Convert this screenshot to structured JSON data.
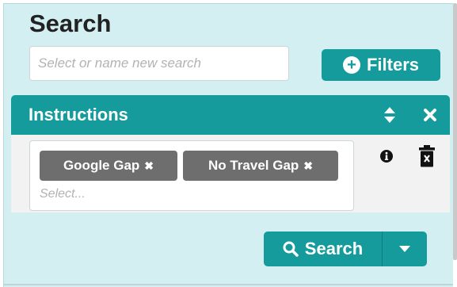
{
  "panel": {
    "title": "Search",
    "search_input": {
      "placeholder": "Select or name new search",
      "value": ""
    },
    "filters_button": {
      "label": "Filters",
      "icon": "plus-circle-icon"
    }
  },
  "instructions": {
    "title": "Instructions",
    "header_icons": [
      "sort-icon",
      "close-icon"
    ],
    "tags": [
      {
        "label": "Google Gap",
        "remove_icon": "close-icon"
      },
      {
        "label": "No Travel Gap",
        "remove_icon": "close-icon"
      }
    ],
    "tag_input_placeholder": "Select...",
    "row_icons": [
      "info-icon",
      "trash-icon"
    ]
  },
  "footer": {
    "search_button": {
      "label": "Search",
      "icon": "search-icon"
    },
    "dropdown_icon": "caret-down-icon"
  },
  "colors": {
    "accent": "#169b9c",
    "panel_bg": "#d3eff2",
    "tag_bg": "#6e6e6e"
  }
}
